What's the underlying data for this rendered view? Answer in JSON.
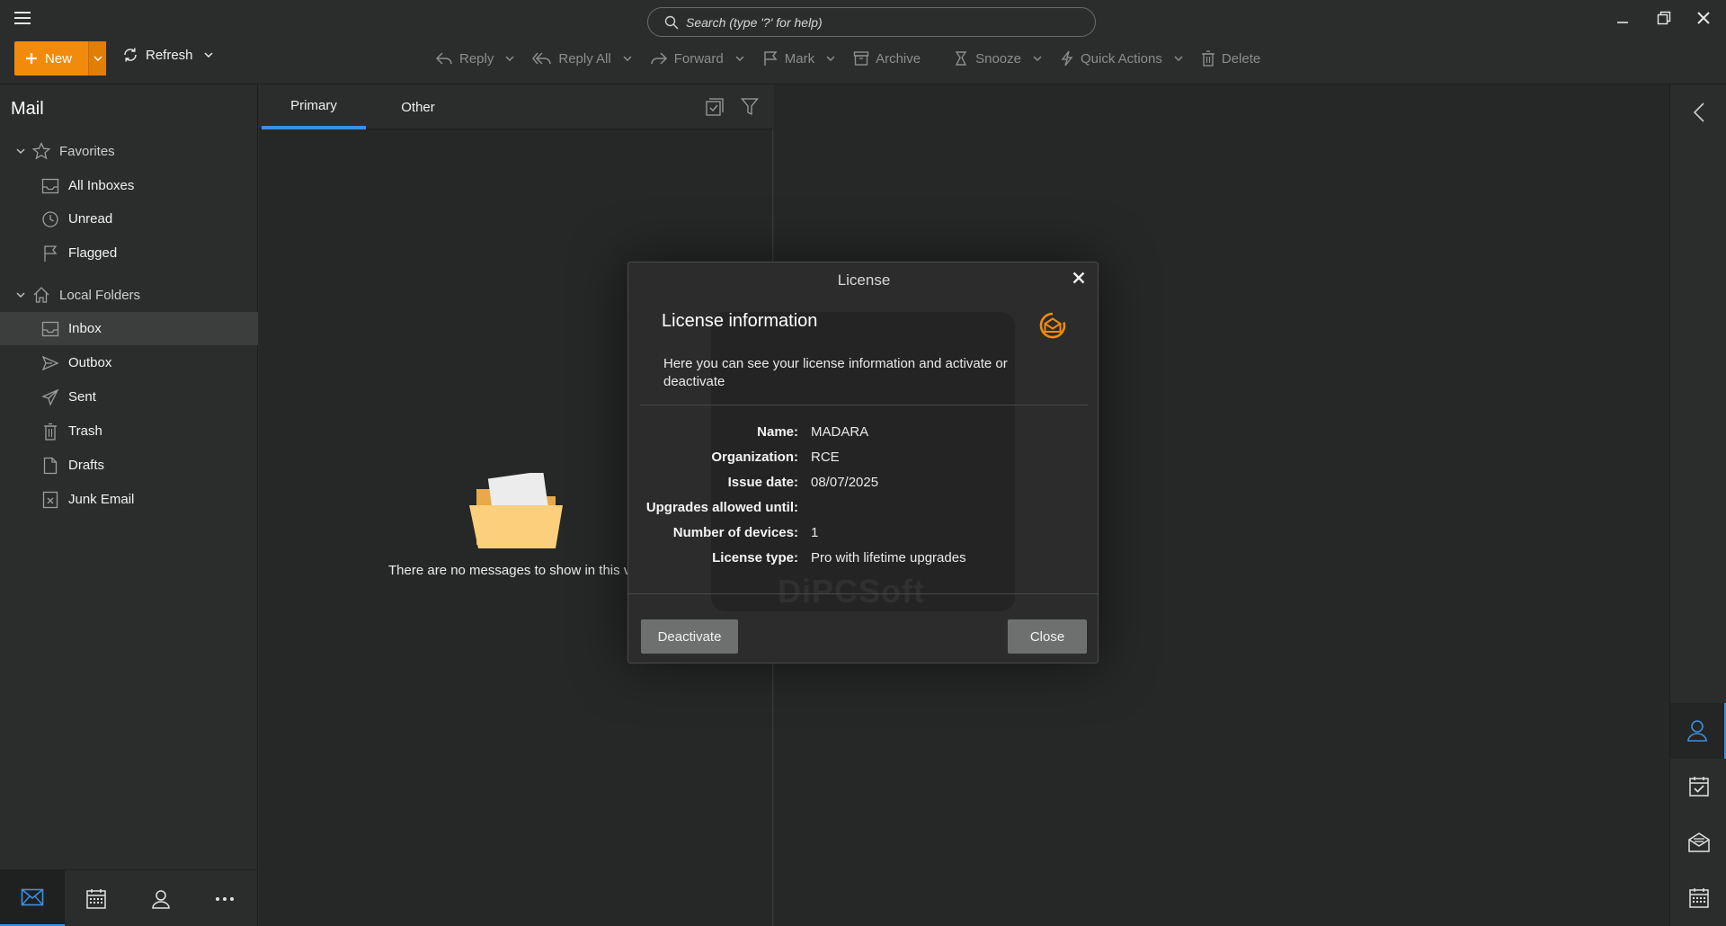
{
  "search": {
    "placeholder": "Search (type '?' for help)"
  },
  "toolbar": {
    "new_label": "New",
    "refresh_label": "Refresh",
    "reply_label": "Reply",
    "reply_all_label": "Reply All",
    "forward_label": "Forward",
    "mark_label": "Mark",
    "archive_label": "Archive",
    "snooze_label": "Snooze",
    "quick_actions_label": "Quick Actions",
    "delete_label": "Delete"
  },
  "sidebar": {
    "title": "Mail",
    "favorites": {
      "label": "Favorites",
      "items": [
        {
          "label": "All Inboxes",
          "icon": "inbox-icon"
        },
        {
          "label": "Unread",
          "icon": "clock-icon"
        },
        {
          "label": "Flagged",
          "icon": "flag-icon"
        }
      ]
    },
    "local_folders": {
      "label": "Local Folders",
      "items": [
        {
          "label": "Inbox",
          "icon": "inbox-icon",
          "active": true
        },
        {
          "label": "Outbox",
          "icon": "outbox-icon"
        },
        {
          "label": "Sent",
          "icon": "sent-icon"
        },
        {
          "label": "Trash",
          "icon": "trash-icon"
        },
        {
          "label": "Drafts",
          "icon": "draft-icon"
        },
        {
          "label": "Junk Email",
          "icon": "junk-icon"
        }
      ]
    }
  },
  "message_list": {
    "tabs": [
      {
        "label": "Primary",
        "active": true
      },
      {
        "label": "Other",
        "active": false
      }
    ],
    "empty_text": "There are no messages to show in this vi"
  },
  "dialog": {
    "window_title": "License",
    "heading": "License information",
    "description": "Here you can see your license information and activate or deactivate",
    "fields": [
      {
        "label": "Name:",
        "value": "MADARA"
      },
      {
        "label": "Organization:",
        "value": "RCE"
      },
      {
        "label": "Issue date:",
        "value": "08/07/2025"
      },
      {
        "label": "Upgrades allowed until:",
        "value": ""
      },
      {
        "label": "Number of devices:",
        "value": "1"
      },
      {
        "label": "License type:",
        "value": "Pro with lifetime upgrades"
      }
    ],
    "deactivate_label": "Deactivate",
    "close_label": "Close",
    "watermark_text": "DiPCSoft"
  },
  "colors": {
    "accent": "#f28b0c",
    "selection": "#3d8fe0",
    "background": "#2b2d2c",
    "pane": "#262827"
  }
}
